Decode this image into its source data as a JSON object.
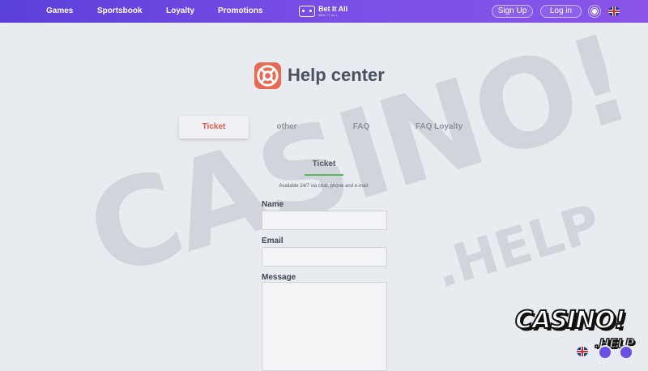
{
  "nav": {
    "items": [
      {
        "label": "Games"
      },
      {
        "label": "Sportsbook"
      },
      {
        "label": "Loyalty"
      },
      {
        "label": "Promotions"
      }
    ],
    "brand_name": "Bet It All",
    "brand_tagline": "WIN IT ALL",
    "signup_label": "Sign Up",
    "login_label": "Log in",
    "theme_icon": "sun-icon",
    "language_icon": "uk-flag-icon"
  },
  "help": {
    "title": "Help center",
    "icon": "lifebuoy-icon",
    "tabs": [
      {
        "label": "Ticket",
        "active": true
      },
      {
        "label": "other",
        "active": false
      },
      {
        "label": "FAQ",
        "active": false
      },
      {
        "label": "FAQ Loyalty",
        "active": false
      }
    ],
    "section_title": "Ticket",
    "availability": "Available 24/7 via chat, phone and e-mail.",
    "form": {
      "name_label": "Name",
      "name_value": "",
      "email_label": "Email",
      "email_value": "",
      "message_label": "Message",
      "message_value": ""
    }
  },
  "watermark": {
    "main": "CASINO!",
    "sub": ".HELP"
  },
  "corner_badge": {
    "main": "CASINO!",
    "sub": ".HELP"
  },
  "colors": {
    "topbar_start": "#5b3fd9",
    "topbar_end": "#8a55e8",
    "accent_red": "#e05a4f",
    "accent_green": "#5cb85c",
    "background": "#e8ebf0"
  }
}
